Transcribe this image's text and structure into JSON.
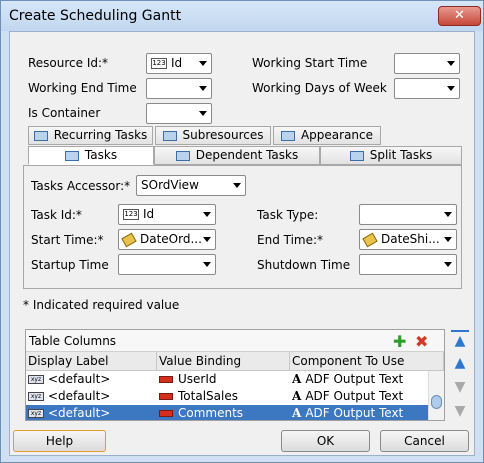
{
  "window": {
    "title": "Create Scheduling Gantt",
    "close_glyph": "✕"
  },
  "form": {
    "resource_id_label": "Resource Id:*",
    "resource_id_value": "Id",
    "resource_id_icon": "123",
    "working_start_time_label": "Working Start Time",
    "working_end_time_label": "Working End Time",
    "working_days_label": "Working Days of Week",
    "is_container_label": "Is Container"
  },
  "tabs_top": [
    {
      "label": "Recurring Tasks",
      "icon": "recurring-icon"
    },
    {
      "label": "Subresources",
      "icon": "subresources-icon"
    },
    {
      "label": "Appearance",
      "icon": "appearance-icon"
    }
  ],
  "tabs_bottom": [
    {
      "label": "Tasks",
      "icon": "tasks-icon"
    },
    {
      "label": "Dependent Tasks",
      "icon": "dependent-icon"
    },
    {
      "label": "Split Tasks",
      "icon": "split-icon"
    }
  ],
  "tasks": {
    "accessor_label": "Tasks Accessor:*",
    "accessor_value": "SOrdView",
    "task_id_label": "Task Id:*",
    "task_id_value": "Id",
    "task_id_icon": "123",
    "task_type_label": "Task Type:",
    "start_time_label": "Start Time:*",
    "start_time_value": "DateOrd...",
    "end_time_label": "End Time:*",
    "end_time_value": "DateShi...",
    "startup_time_label": "Startup Time",
    "shutdown_time_label": "Shutdown Time"
  },
  "required_note": "* Indicated required value",
  "table": {
    "title": "Table Columns",
    "add_glyph": "✚",
    "delete_glyph": "✖",
    "columns": [
      "Display Label",
      "Value Binding",
      "Component To Use"
    ],
    "rows": [
      {
        "display": "<default>",
        "binding": "UserId",
        "component": "ADF Output Text",
        "selected": false
      },
      {
        "display": "<default>",
        "binding": "TotalSales",
        "component": "ADF Output Text",
        "selected": false
      },
      {
        "display": "<default>",
        "binding": "Comments",
        "component": "ADF Output Text",
        "selected": true
      }
    ],
    "xyz_icon": "xyz"
  },
  "buttons": {
    "help": "Help",
    "ok": "OK",
    "cancel": "Cancel"
  },
  "colors": {
    "accent": "#3c77c2",
    "titlebar": "#c1d7f0",
    "close": "#c7483a",
    "add": "#2e9e2a",
    "delete": "#d23a2a"
  }
}
